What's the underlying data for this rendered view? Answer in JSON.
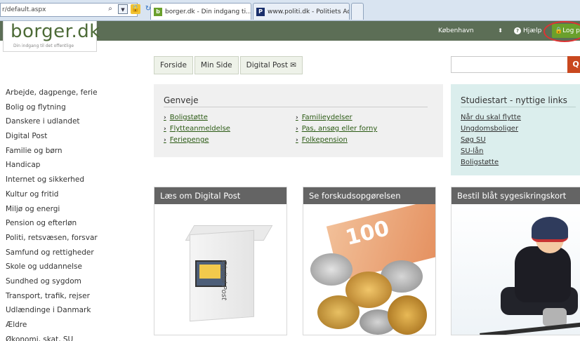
{
  "browser": {
    "address": "r/default.aspx",
    "tabs": [
      {
        "label": "borger.dk - Din indgang ti...",
        "close": "✕"
      },
      {
        "label": "www.politi.dk - Politiets Adm..."
      }
    ],
    "favicon_borger": "b",
    "favicon_politi": "P"
  },
  "header": {
    "logo": "borger.dk",
    "tagline": "Din indgang  til det offentlige",
    "region": "København",
    "region_arrow": "⬍",
    "help": "Hjælp",
    "login": "🔒Log på",
    "accent_color": "#6aa02c",
    "bar_color": "#5c6e56"
  },
  "nav": {
    "tabs": [
      "Forside",
      "Min Side",
      "Digital Post ✉"
    ]
  },
  "search": {
    "placeholder": "",
    "button": "Q"
  },
  "sidebar": {
    "items": [
      "Arbejde, dagpenge, ferie",
      "Bolig og flytning",
      "Danskere i udlandet",
      "Digital Post",
      "Familie og børn",
      "Handicap",
      "Internet og sikkerhed",
      "Kultur og fritid",
      "Miljø og energi",
      "Pension og efterløn",
      "Politi, retsvæsen, forsvar",
      "Samfund og rettigheder",
      "Skole og uddannelse",
      "Sundhed og sygdom",
      "Transport, trafik, rejser",
      "Udlændinge i Danmark",
      "Ældre",
      "Økonomi, skat, SU"
    ]
  },
  "genveje": {
    "title": "Genveje",
    "col1": [
      "Boligstøtte",
      "Flytteanmeldelse",
      "Feriepenge"
    ],
    "col2": [
      "Familieydelser",
      "Pas, ansøg eller forny",
      "Folkepension"
    ]
  },
  "study": {
    "title": "Studiestart - nyttige links",
    "links": [
      "Når du skal flytte",
      "Ungdomsboliger",
      "Søg SU",
      "SU-lån",
      "Boligstøtte"
    ]
  },
  "cards": [
    {
      "title": "Læs om Digital Post",
      "image_text": "Digital Post"
    },
    {
      "title": "Se forskudsopgørelsen",
      "image_text": "100"
    },
    {
      "title": "Bestil blåt sygesikringskort"
    }
  ]
}
